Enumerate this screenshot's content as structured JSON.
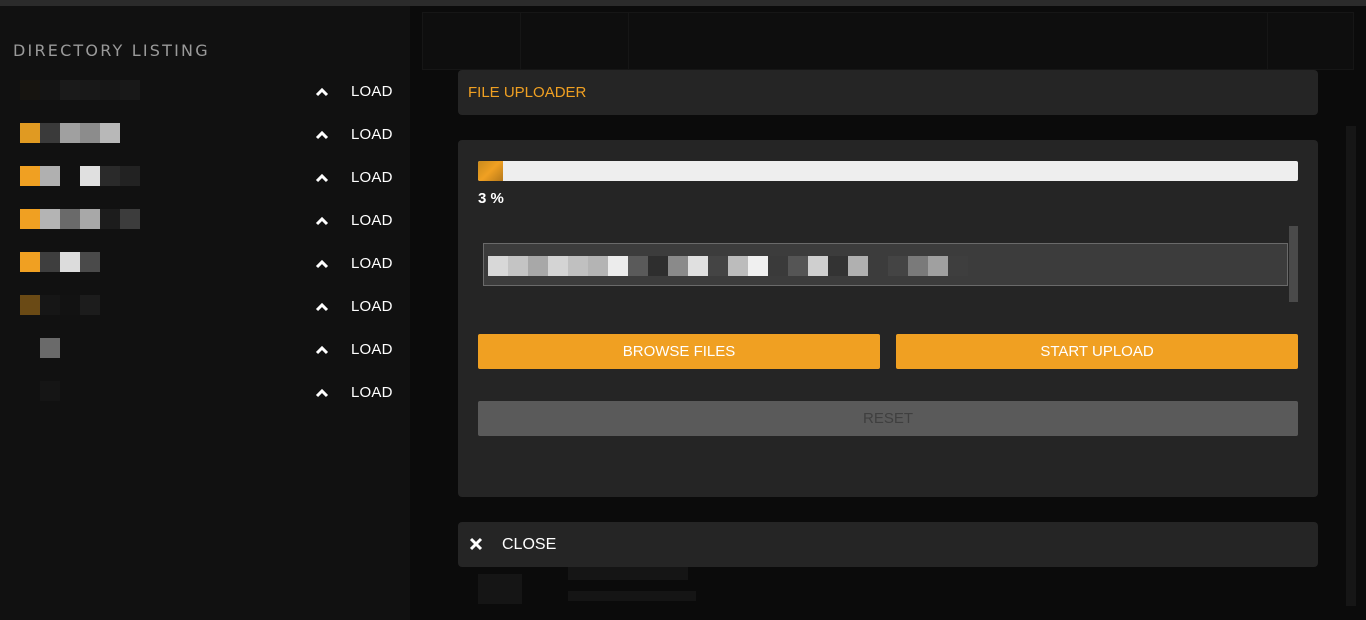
{
  "sidebar": {
    "title": "DIRECTORY LISTING",
    "items": [
      {
        "load_label": "LOAD",
        "icon": "chevron-up-icon"
      },
      {
        "load_label": "LOAD",
        "icon": "chevron-up-icon"
      },
      {
        "load_label": "LOAD",
        "icon": "chevron-up-icon"
      },
      {
        "load_label": "LOAD",
        "icon": "chevron-up-icon"
      },
      {
        "load_label": "LOAD",
        "icon": "chevron-up-icon"
      },
      {
        "load_label": "LOAD",
        "icon": "chevron-up-icon"
      },
      {
        "load_label": "LOAD",
        "icon": "chevron-up-icon"
      },
      {
        "load_label": "LOAD",
        "icon": "chevron-up-icon"
      }
    ]
  },
  "uploader": {
    "title": "FILE UPLOADER",
    "progress_percent": 3,
    "progress_text": "3 %",
    "browse_label": "BROWSE FILES",
    "start_label": "START UPLOAD",
    "reset_label": "RESET",
    "close_label": "CLOSE",
    "close_icon": "close-icon"
  },
  "colors": {
    "accent": "#f0a022",
    "panel": "#252525",
    "sidebar": "#111111",
    "reset": "#5a5a5a"
  }
}
